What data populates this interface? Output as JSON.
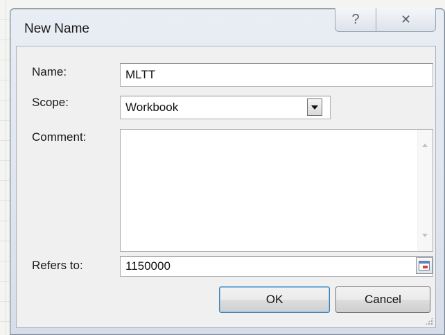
{
  "dialog": {
    "title": "New Name",
    "help_icon": "help-question-icon",
    "help_glyph": "?",
    "close_icon": "close-icon",
    "close_glyph": "✕"
  },
  "form": {
    "name_label": "Name:",
    "name_value": "MLTT",
    "scope_label": "Scope:",
    "scope_value": "Workbook",
    "comment_label": "Comment:",
    "comment_value": "",
    "refers_label": "Refers to:",
    "refers_value": "1150000"
  },
  "buttons": {
    "ok": "OK",
    "cancel": "Cancel"
  }
}
